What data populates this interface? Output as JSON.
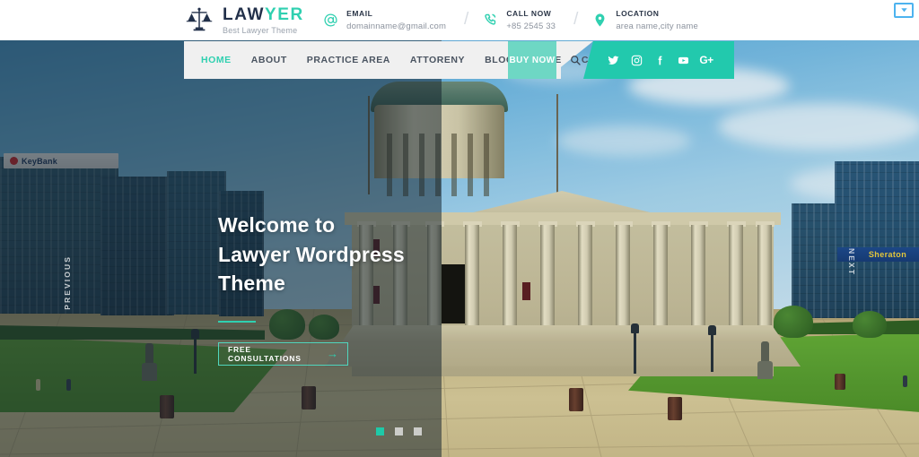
{
  "topbar": {
    "brand": {
      "name_dark": "LAW",
      "name_accent": "YER",
      "tagline": "Best Lawyer Theme",
      "logo_icon": "scales-of-justice-icon"
    },
    "contacts": [
      {
        "icon": "at-sign-icon",
        "label": "EMAIL",
        "value": "domainname@gmail.com"
      },
      {
        "icon": "phone-call-icon",
        "label": "CALL NOW",
        "value": "+85 2545 33"
      },
      {
        "icon": "map-pin-icon",
        "label": "LOCATION",
        "value": "area name,city name"
      }
    ],
    "corner_icon": "download-box-icon"
  },
  "nav": {
    "items": [
      {
        "label": "HOME",
        "active": true
      },
      {
        "label": "ABOUT",
        "active": false
      },
      {
        "label": "PRACTICE AREA",
        "active": false
      },
      {
        "label": "ATTORENY",
        "active": false
      },
      {
        "label": "BLOG",
        "active": false
      },
      {
        "label": "PAGE",
        "active": false
      },
      {
        "label": "CONTACT",
        "active": false
      }
    ],
    "buy_now": "BUY NOW",
    "search_icon": "search-icon",
    "social": [
      {
        "name": "twitter-icon"
      },
      {
        "name": "instagram-icon"
      },
      {
        "name": "facebook-icon"
      },
      {
        "name": "youtube-icon"
      },
      {
        "name": "google-plus-icon"
      }
    ]
  },
  "hero": {
    "title_line1": "Welcome to",
    "title_line2": "Lawyer Wordpress",
    "title_line3": "Theme",
    "cta_label": "FREE CONSULTATIONS",
    "cta_arrow": "→",
    "prev_label": "PREVIOUS",
    "next_label": "NEXT",
    "slides": [
      {
        "active": true
      },
      {
        "active": false
      },
      {
        "active": false
      }
    ],
    "scene": {
      "building_sign_left": "KeyBank",
      "building_sign_right": "Sheraton"
    }
  },
  "colors": {
    "accent_teal": "#2fd0b0",
    "social_bar": "#22c9ad",
    "buy_now": "#6ed7c4",
    "nav_bg": "#f0f0f0",
    "brand_dark": "#22304a",
    "corner_blue": "#4db3ef"
  }
}
